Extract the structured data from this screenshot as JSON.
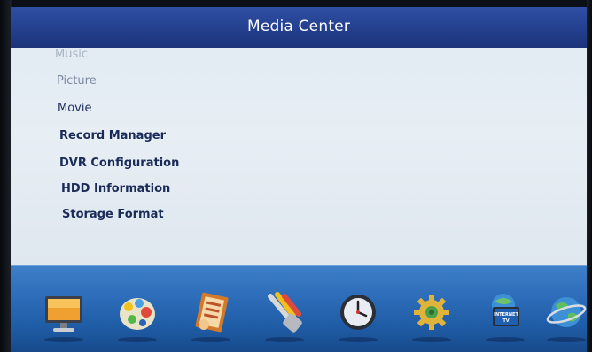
{
  "header": {
    "title": "Media Center"
  },
  "menu": {
    "items": [
      {
        "label": "Music"
      },
      {
        "label": "Picture"
      },
      {
        "label": "Movie"
      },
      {
        "label": "Record Manager"
      },
      {
        "label": "DVR Configuration"
      },
      {
        "label": "HDD Information"
      },
      {
        "label": "Storage Format"
      }
    ]
  },
  "dock": {
    "icons": [
      {
        "icon": "tv-monitor-icon"
      },
      {
        "icon": "media-palette-icon"
      },
      {
        "icon": "program-guide-icon"
      },
      {
        "icon": "av-cables-icon"
      },
      {
        "icon": "clock-icon"
      },
      {
        "icon": "settings-gear-icon"
      },
      {
        "icon": "internet-tv-icon",
        "caption": "INTERNET TV"
      },
      {
        "icon": "globe-network-icon"
      }
    ]
  },
  "colors": {
    "title_bar": "#233f8e",
    "content_bg": "#e5edf3",
    "dock": "#2d6db9",
    "menu_text": "#1b2d5c"
  }
}
